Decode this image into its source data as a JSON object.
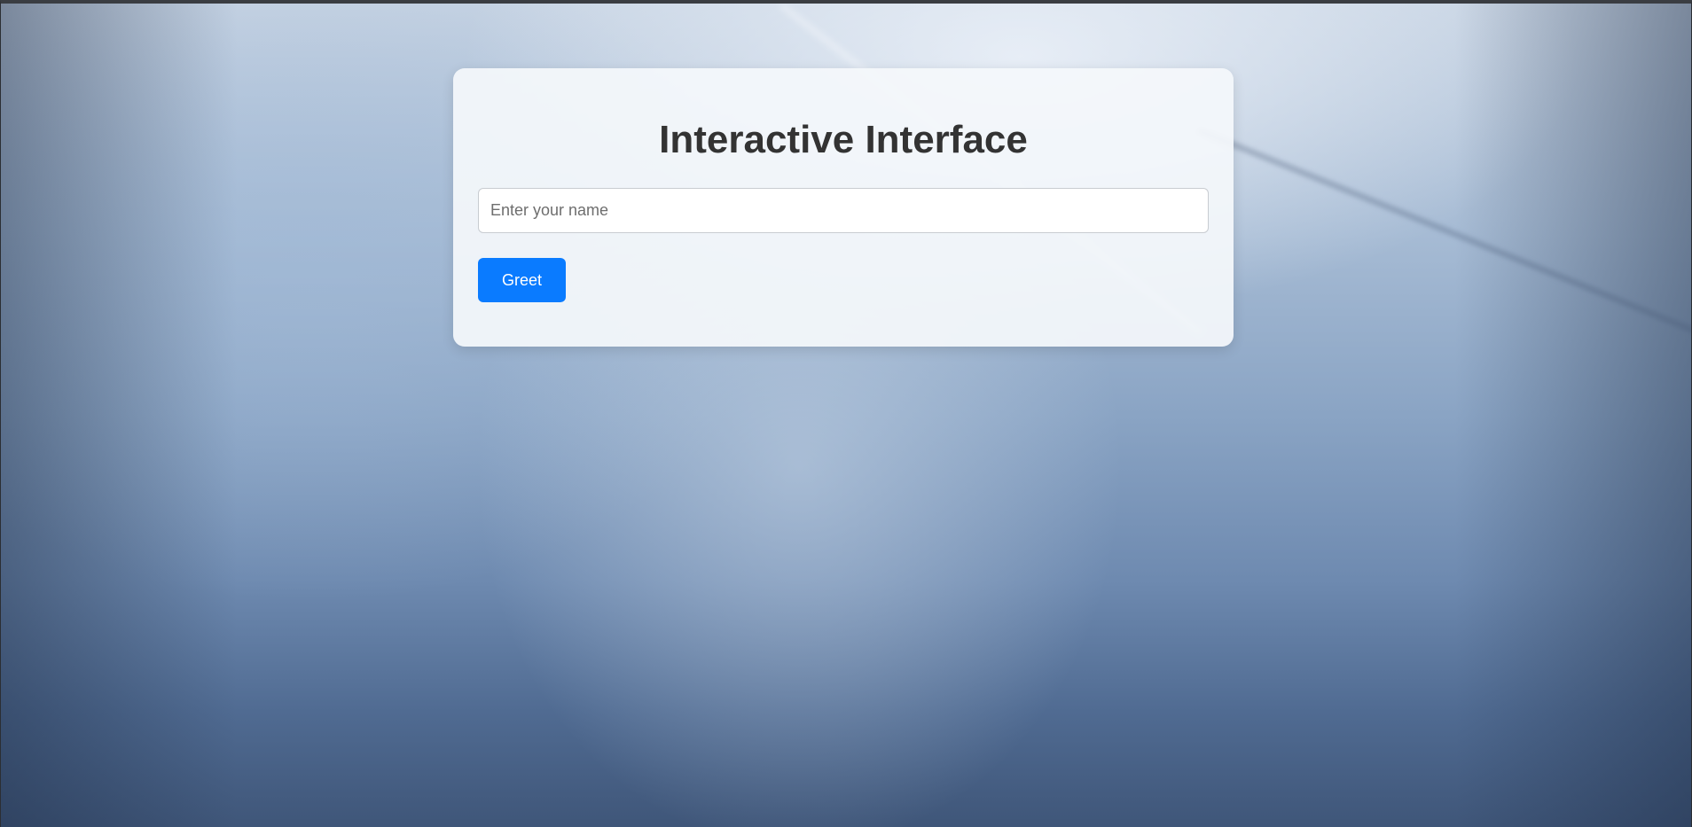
{
  "page": {
    "title": "Interactive Interface"
  },
  "form": {
    "name_input": {
      "value": "",
      "placeholder": "Enter your name"
    },
    "greet_button_label": "Greet"
  },
  "colors": {
    "accent": "#0a7bff",
    "title_text": "#333333",
    "card_background": "#f4f7fb"
  }
}
